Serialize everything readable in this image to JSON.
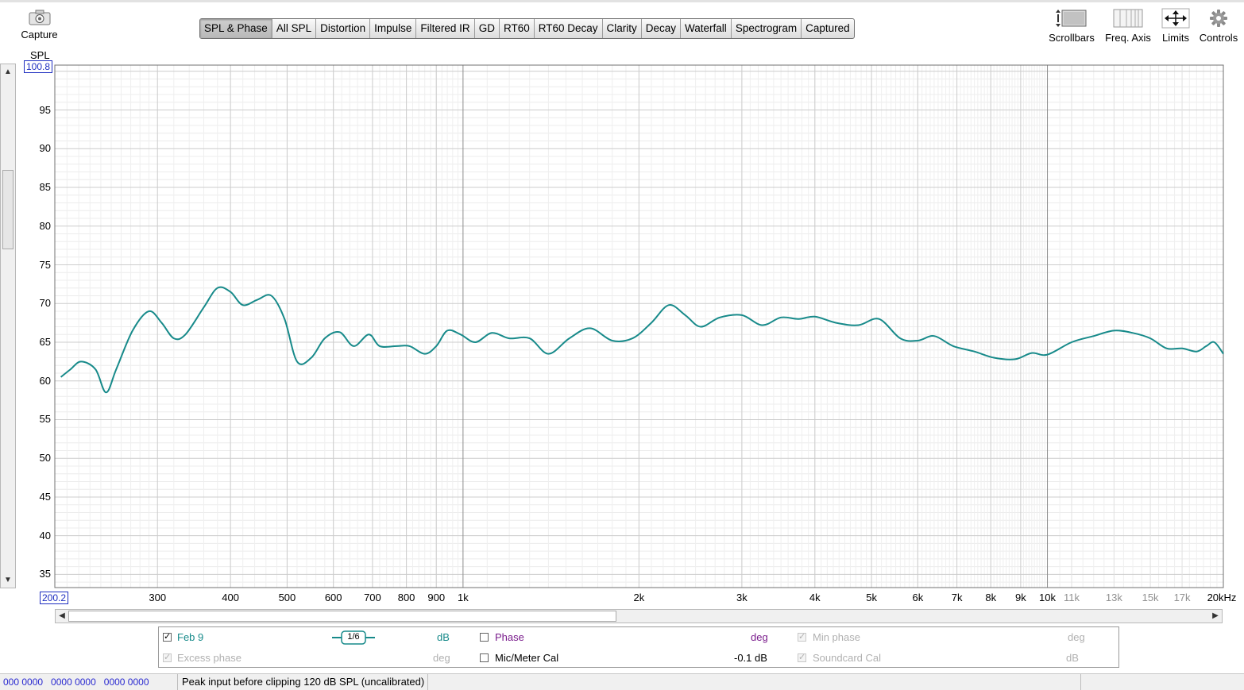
{
  "toolbar": {
    "capture_label": "Capture",
    "capture_icon": "camera-icon",
    "scrollbars_label": "Scrollbars",
    "freq_axis_label": "Freq. Axis",
    "limits_label": "Limits",
    "controls_label": "Controls"
  },
  "tabs": [
    {
      "label": "SPL & Phase",
      "active": true
    },
    {
      "label": "All SPL"
    },
    {
      "label": "Distortion"
    },
    {
      "label": "Impulse"
    },
    {
      "label": "Filtered IR"
    },
    {
      "label": "GD"
    },
    {
      "label": "RT60"
    },
    {
      "label": "RT60 Decay"
    },
    {
      "label": "Clarity"
    },
    {
      "label": "Decay"
    },
    {
      "label": "Waterfall"
    },
    {
      "label": "Spectrogram"
    },
    {
      "label": "Captured"
    }
  ],
  "graph": {
    "y_axis_title": "SPL",
    "y_top_value": "100.8",
    "x_left_value": "200.2"
  },
  "chart_data": {
    "type": "line",
    "xlabel": "",
    "ylabel": "SPL",
    "x_scale": "log",
    "xlim": [
      200.2,
      20000
    ],
    "ylim": [
      33.3,
      100.8
    ],
    "grid": true,
    "y_ticks": [
      35,
      40,
      45,
      50,
      55,
      60,
      65,
      70,
      75,
      80,
      85,
      90,
      95,
      100
    ],
    "x_ticks": [
      {
        "value": 300,
        "label": "300"
      },
      {
        "value": 400,
        "label": "400"
      },
      {
        "value": 500,
        "label": "500"
      },
      {
        "value": 600,
        "label": "600"
      },
      {
        "value": 700,
        "label": "700"
      },
      {
        "value": 800,
        "label": "800"
      },
      {
        "value": 900,
        "label": "900"
      },
      {
        "value": 1000,
        "label": "1k"
      },
      {
        "value": 2000,
        "label": "2k"
      },
      {
        "value": 3000,
        "label": "3k"
      },
      {
        "value": 4000,
        "label": "4k"
      },
      {
        "value": 5000,
        "label": "5k"
      },
      {
        "value": 6000,
        "label": "6k"
      },
      {
        "value": 7000,
        "label": "7k"
      },
      {
        "value": 8000,
        "label": "8k"
      },
      {
        "value": 9000,
        "label": "9k"
      },
      {
        "value": 10000,
        "label": "10k"
      },
      {
        "value": 11000,
        "label": "11k",
        "minor": true
      },
      {
        "value": 13000,
        "label": "13k",
        "minor": true
      },
      {
        "value": 15000,
        "label": "15k",
        "minor": true
      },
      {
        "value": 17000,
        "label": "17k",
        "minor": true
      },
      {
        "value": 20000,
        "label": "20kHz"
      }
    ],
    "series": [
      {
        "name": "Feb 9",
        "color": "#178a8a",
        "x": [
          205,
          213,
          222,
          235,
          245,
          255,
          272,
          290,
          305,
          320,
          335,
          360,
          380,
          400,
          420,
          445,
          470,
          495,
          520,
          550,
          580,
          615,
          650,
          690,
          720,
          770,
          810,
          860,
          900,
          940,
          990,
          1050,
          1120,
          1200,
          1300,
          1400,
          1520,
          1650,
          1800,
          1950,
          2100,
          2250,
          2400,
          2550,
          2750,
          3000,
          3250,
          3500,
          3750,
          4000,
          4350,
          4750,
          5150,
          5600,
          6000,
          6400,
          6900,
          7500,
          8100,
          8800,
          9400,
          10000,
          11000,
          12000,
          13000,
          14000,
          15000,
          16000,
          17000,
          18000,
          18700,
          19300,
          20000
        ],
        "y": [
          60.5,
          61.5,
          62.5,
          61.5,
          58.5,
          61.5,
          66.5,
          69.0,
          67.5,
          65.5,
          66.0,
          69.5,
          72.0,
          71.5,
          69.8,
          70.5,
          71.0,
          68.0,
          62.5,
          63.0,
          65.5,
          66.3,
          64.5,
          66.0,
          64.5,
          64.5,
          64.5,
          63.5,
          64.5,
          66.5,
          66.0,
          65.0,
          66.2,
          65.5,
          65.5,
          63.5,
          65.5,
          66.8,
          65.2,
          65.5,
          67.5,
          69.8,
          68.5,
          67.0,
          68.2,
          68.5,
          67.2,
          68.2,
          68.0,
          68.3,
          67.5,
          67.2,
          68.0,
          65.5,
          65.2,
          65.8,
          64.5,
          63.8,
          63.0,
          62.8,
          63.6,
          63.4,
          65.0,
          65.8,
          66.5,
          66.2,
          65.5,
          64.2,
          64.2,
          63.8,
          64.5,
          65.0,
          63.5
        ]
      }
    ]
  },
  "legend": {
    "series_name": "Feb 9",
    "smoothing": "1/6",
    "spl_unit": "dB",
    "phase_label": "Phase",
    "phase_unit": "deg",
    "min_phase_label": "Min phase",
    "min_phase_unit": "deg",
    "excess_phase_label": "Excess phase",
    "excess_phase_unit": "deg",
    "mic_cal_label": "Mic/Meter Cal",
    "mic_cal_value": "-0.1 dB",
    "soundcard_cal_label": "Soundcard Cal",
    "soundcard_cal_unit": "dB",
    "colors": {
      "spl": "#178a8a",
      "phase": "#7a1c8c",
      "disabled": "#b0b0b0"
    }
  },
  "status": {
    "meters": "000 0000   0000 0000   0000 0000",
    "peak_text": "Peak input before clipping 120 dB SPL (uncalibrated)"
  }
}
